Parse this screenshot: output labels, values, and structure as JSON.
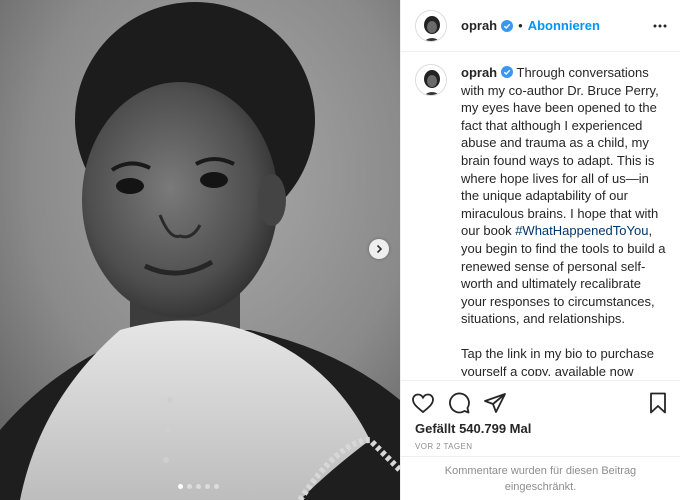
{
  "post": {
    "image_alt": "Black-and-white childhood portrait photo",
    "carousel_dots": 5,
    "carousel_active": 0
  },
  "header": {
    "username": "oprah",
    "separator": "•",
    "follow_label": "Abonnieren"
  },
  "caption": {
    "username": "oprah",
    "text_part1": " Through conversations with my co-author Dr. Bruce Perry, my eyes have been opened to the fact that although I experienced abuse and trauma as a child, my brain found ways to adapt. This is where hope lives for all of us—in the unique adaptability of our miraculous brains. I hope that with our book ",
    "hashtag": "#WhatHappenedToYou",
    "text_part2": ", you begin to find the tools to build a renewed sense of personal self-worth and ultimately recalibrate your responses to circumstances, situations, and relationships.",
    "text_para2": "Tap the link in my bio to purchase yourself a copy, available now wherever you buy or download your books from. All of my proceeds made"
  },
  "stats": {
    "likes": "Gefällt 540.799 Mal",
    "time_ago": "VOR 2 TAGEN"
  },
  "comments_closed": "Kommentare wurden für diesen Beitrag eingeschränkt.",
  "icons": {
    "verified": "verified-badge-icon",
    "more": "more-options-icon",
    "like": "heart-icon",
    "comment": "comment-icon",
    "share": "share-icon",
    "save": "bookmark-icon",
    "next": "chevron-right-icon"
  },
  "colors": {
    "accent": "#0095f6",
    "hashtag": "#00376b",
    "muted": "#8e8e8e"
  }
}
